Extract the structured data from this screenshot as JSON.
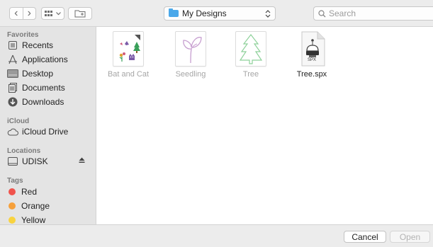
{
  "toolbar": {
    "location": "My Designs",
    "search_placeholder": "Search",
    "back_glyph": "‹",
    "forward_glyph": "›"
  },
  "sidebar": {
    "sections": {
      "favorites": "Favorites",
      "icloud": "iCloud",
      "locations": "Locations",
      "tags": "Tags"
    },
    "favorites": [
      {
        "label": "Recents",
        "icon": "recents-icon"
      },
      {
        "label": "Applications",
        "icon": "applications-icon"
      },
      {
        "label": "Desktop",
        "icon": "desktop-icon"
      },
      {
        "label": "Documents",
        "icon": "documents-icon"
      },
      {
        "label": "Downloads",
        "icon": "downloads-icon"
      }
    ],
    "icloud": [
      {
        "label": "iCloud Drive",
        "icon": "cloud-icon"
      }
    ],
    "locations": [
      {
        "label": "UDISK",
        "icon": "disk-icon"
      }
    ],
    "tags": [
      {
        "label": "Red",
        "color": "#f0534c"
      },
      {
        "label": "Orange",
        "color": "#f6a03a"
      },
      {
        "label": "Yellow",
        "color": "#f8d33f"
      }
    ]
  },
  "files": [
    {
      "label": "Bat and Cat",
      "enabled": false,
      "icon": "bat-and-cat-thumbnail"
    },
    {
      "label": "Seedling",
      "enabled": false,
      "icon": "seedling-thumbnail"
    },
    {
      "label": "Tree",
      "enabled": false,
      "icon": "tree-thumbnail"
    },
    {
      "label": "Tree.spx",
      "enabled": true,
      "icon": "spx-file-icon",
      "badge": "SPX"
    }
  ],
  "buttons": {
    "cancel": "Cancel",
    "open": "Open"
  },
  "colors": {
    "accent": "#4aa8ea"
  }
}
